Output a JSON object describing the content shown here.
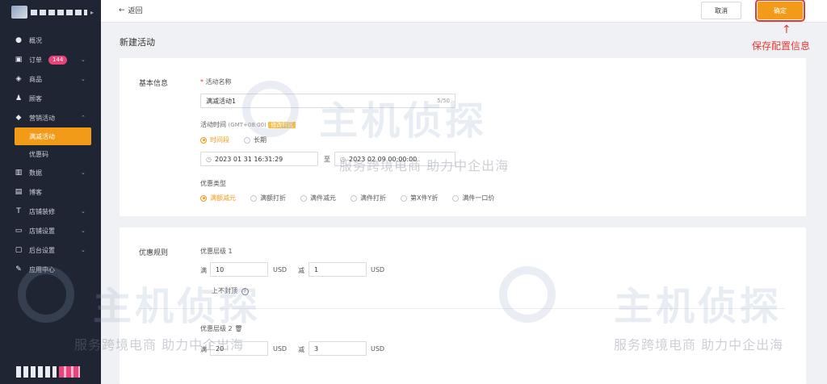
{
  "topbar": {
    "back_label": "返回",
    "cancel_label": "取消",
    "ok_label": "确定"
  },
  "annotation": {
    "arrow": "↑",
    "text": "保存配置信息"
  },
  "sidebar": {
    "items": [
      {
        "icon": "●",
        "label": "概况"
      },
      {
        "icon": "▣",
        "label": "订单",
        "badge": "144",
        "chevron": "⌄"
      },
      {
        "icon": "◈",
        "label": "商品",
        "chevron": "⌄"
      },
      {
        "icon": "♟",
        "label": "顾客"
      },
      {
        "icon": "◆",
        "label": "营销活动",
        "chevron": "⌃"
      }
    ],
    "sub_items": [
      {
        "label": "满减活动"
      },
      {
        "label": "优惠码"
      }
    ],
    "items2": [
      {
        "icon": "▥",
        "label": "数据",
        "chevron": "⌄"
      },
      {
        "icon": "▤",
        "label": "博客"
      },
      {
        "icon": "T",
        "label": "店铺装修",
        "chevron": "⌄"
      },
      {
        "icon": "▭",
        "label": "店铺设置",
        "chevron": "⌄"
      },
      {
        "icon": "▢",
        "label": "后台设置",
        "chevron": "⌄"
      },
      {
        "icon": "✎",
        "label": "应用中心"
      }
    ]
  },
  "page": {
    "title": "新建活动"
  },
  "basic": {
    "section_title": "基本信息",
    "name_label": "活动名称",
    "name_value": "满减活动1",
    "name_counter": "5/50",
    "time_label": "活动时间",
    "time_tz": "(GMT+08:00)",
    "time_tz_tag": "修改时区",
    "time_options": [
      "时间段",
      "长期"
    ],
    "start_time": "2023 01 31 16:31:29",
    "to_label": "至",
    "end_time": "2023 02 09 00:00:00",
    "type_label": "优惠类型",
    "type_options": [
      "满额减元",
      "满额打折",
      "满件减元",
      "满件打折",
      "第X件Y折",
      "满件一口价"
    ]
  },
  "rules": {
    "section_title": "优惠规则",
    "level1_label": "优惠层级 1",
    "level2_label": "优惠层级 2",
    "full_label": "满",
    "minus_label": "减",
    "currency": "USD",
    "level1_full": "10",
    "level1_minus": "1",
    "level2_full": "20",
    "level2_minus": "3",
    "cap_label": "上不封顶",
    "help_icon": "?",
    "trash_icon": "🗑"
  },
  "watermark": {
    "main": "主机侦探",
    "sub": "服务跨境电商 助力中企出海"
  }
}
